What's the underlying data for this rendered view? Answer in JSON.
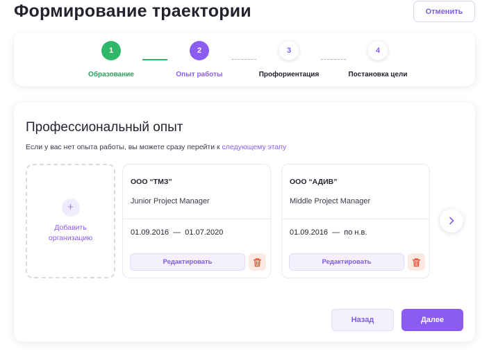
{
  "header": {
    "title": "Формирование траектории",
    "cancel_label": "Отменить"
  },
  "stepper": {
    "steps": [
      {
        "number": "1",
        "label": "Образование",
        "status": "done"
      },
      {
        "number": "2",
        "label": "Опыт работы",
        "status": "active"
      },
      {
        "number": "3",
        "label": "Профориентация",
        "status": "pending"
      },
      {
        "number": "4",
        "label": "Постановка цели",
        "status": "pending"
      }
    ]
  },
  "section": {
    "title": "Профессиональный опыт",
    "subtitle_text": "Если у вас нет опыта работы, вы можете сразу перейти к ",
    "subtitle_link": "следующему этапу"
  },
  "add_org": {
    "plus": "+",
    "label_line1": "Добавить",
    "label_line2": "организацию"
  },
  "organizations": [
    {
      "name": "ООО “ТМЗ”",
      "position": "Junior Project Manager",
      "dates": "01.09.2016  —  01.07.2020",
      "edit_label": "Редактировать"
    },
    {
      "name": "ООО “АДИВ”",
      "position": "Middle Project Manager",
      "dates": "01.09.2016  —  по н.в.",
      "edit_label": "Редактировать"
    }
  ],
  "footer": {
    "back_label": "Назад",
    "next_label": "Далее"
  },
  "colors": {
    "accent": "#8a5cf0",
    "success": "#2fb86a",
    "danger": "#e8553a"
  },
  "icons": {
    "delete": "trash-icon",
    "carousel_next": "chevron-right-icon",
    "add": "plus-icon"
  }
}
